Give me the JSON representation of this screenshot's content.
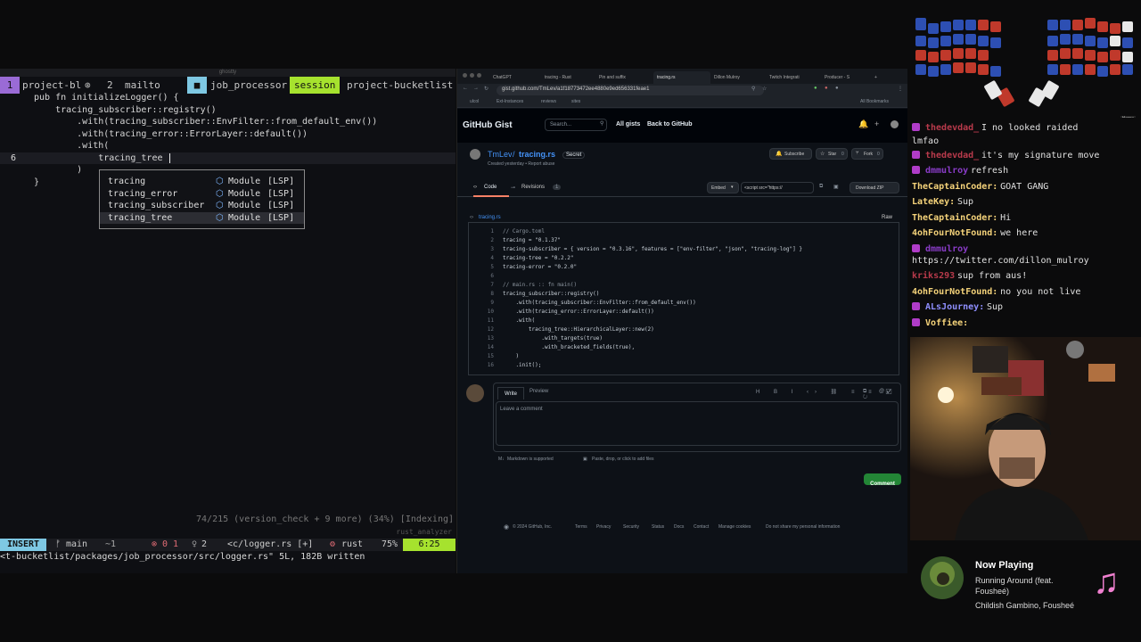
{
  "terminal": {
    "window_title": "ghostty",
    "tabs": [
      {
        "index": "1",
        "label": "project-bl"
      },
      {
        "index": "2",
        "label": "mailto"
      },
      {
        "label": "job_processor"
      },
      {
        "label": "session"
      },
      {
        "label": "project-bucketlist"
      }
    ],
    "code_lines": [
      {
        "ln": "",
        "text": "pub fn initializeLogger() {"
      },
      {
        "ln": "",
        "text": "    tracing_subscriber::registry()"
      },
      {
        "ln": "",
        "text": "        .with(tracing_subscriber::EnvFilter::from_default_env())"
      },
      {
        "ln": "",
        "text": "        .with(tracing_error::ErrorLayer::default())"
      },
      {
        "ln": "",
        "text": "        .with("
      },
      {
        "ln": "6",
        "text": "            tracing_tree"
      },
      {
        "ln": "",
        "text": "        )"
      },
      {
        "ln": "",
        "text": "}"
      }
    ],
    "completions": [
      {
        "name": "tracing",
        "kind": "Module",
        "src": "[LSP]"
      },
      {
        "name": "tracing_error",
        "kind": "Module",
        "src": "[LSP]"
      },
      {
        "name": "tracing_subscriber",
        "kind": "Module",
        "src": "[LSP]"
      },
      {
        "name": "tracing_tree",
        "kind": "Module",
        "src": "[LSP]"
      }
    ],
    "lsp_progress": "74/215 (version_check + 9 more) (34%) [Indexing]",
    "lsp_name": "rust_analyzer",
    "status": {
      "mode": "INSERT",
      "branch": "main",
      "diff": "~1",
      "errors": "0 1",
      "warnings": "1",
      "hints": "2",
      "file": "<c/logger.rs [+]",
      "filetype": "rust",
      "percent": "75%",
      "position": "6:25"
    },
    "cmdline": "<t-bucketlist/packages/job_processor/src/logger.rs\" 5L, 182B written"
  },
  "browser": {
    "tabs": [
      "ChatGPT",
      "tracing - Rust",
      "Pin and suffix",
      "tracing.rs",
      "Dillon Mulroy",
      "Twitch Integrati",
      "Producer - S"
    ],
    "url": "gist.github.com/TmLev/a1f18773472ee4880e9ed656331feae1",
    "bookmarks": [
      "ulcol",
      "Ext-Instances",
      "reviews",
      "sites"
    ],
    "all_bookmarks": "All Bookmarks",
    "logo": "GitHub Gist",
    "search_placeholder": "Search...",
    "nav": [
      "All gists",
      "Back to GitHub"
    ],
    "owner": "TmLev",
    "file": "tracing.rs",
    "secret_badge": "Secret",
    "created": "Created yesterday • Report abuse",
    "subscribe": "Subscribe",
    "star": "Star",
    "star_count": "0",
    "fork": "Fork",
    "fork_count": "0",
    "code_tab": "Code",
    "revisions_tab": "Revisions",
    "revisions_count": "1",
    "embed": "Embed",
    "embed_value": "<script src=\"https://",
    "download": "Download ZIP",
    "filename": "tracing.rs",
    "raw": "Raw",
    "gist_lines": [
      {
        "n": "1",
        "t": "// Cargo.toml"
      },
      {
        "n": "2",
        "t": "tracing = \"0.1.37\""
      },
      {
        "n": "3",
        "t": "tracing-subscriber = { version = \"0.3.16\", features = [\"env-filter\", \"json\", \"tracing-log\"] }"
      },
      {
        "n": "4",
        "t": "tracing-tree = \"0.2.2\""
      },
      {
        "n": "5",
        "t": "tracing-error = \"0.2.0\""
      },
      {
        "n": "6",
        "t": ""
      },
      {
        "n": "7",
        "t": "// main.rs :: fn main()"
      },
      {
        "n": "8",
        "t": "tracing_subscriber::registry()"
      },
      {
        "n": "9",
        "t": "    .with(tracing_subscriber::EnvFilter::from_default_env())"
      },
      {
        "n": "10",
        "t": "    .with(tracing_error::ErrorLayer::default())"
      },
      {
        "n": "11",
        "t": "    .with("
      },
      {
        "n": "12",
        "t": "        tracing_tree::HierarchicalLayer::new(2)"
      },
      {
        "n": "13",
        "t": "            .with_targets(true)"
      },
      {
        "n": "14",
        "t": "            .with_bracketed_fields(true),"
      },
      {
        "n": "15",
        "t": "    )"
      },
      {
        "n": "16",
        "t": "    .init();"
      }
    ],
    "comment": {
      "write_tab": "Write",
      "preview_tab": "Preview",
      "placeholder": "Leave a comment",
      "markdown_note": "Markdown is supported",
      "attach_note": "Paste, drop, or click to add files",
      "submit": "Comment"
    },
    "footer": [
      "© 2024 GitHub, Inc.",
      "Terms",
      "Privacy",
      "Security",
      "Status",
      "Docs",
      "Contact",
      "Manage cookies",
      "Do not share my personal information"
    ]
  },
  "chat": {
    "messages": [
      {
        "user": "thedevdad_",
        "text": "I no looked raided",
        "color": "#b83a4b",
        "badge": "#b03cc8"
      },
      {
        "user": "",
        "text": "lmfao",
        "color": "#e0e0e0",
        "badge": ""
      },
      {
        "user": "thedevdad_",
        "text": "it's my signature move",
        "color": "#b83a4b",
        "badge": "#b03cc8"
      },
      {
        "user": "dmmulroy",
        "text": "refresh",
        "color": "#8a3cc8",
        "badge": "#b03cc8"
      },
      {
        "user": "TheCaptainCoder:",
        "text": "GOAT GANG",
        "color": "#f5d37a",
        "badge": ""
      },
      {
        "user": "LateKey:",
        "text": "Sup",
        "color": "#f5d37a",
        "badge": ""
      },
      {
        "user": "TheCaptainCoder:",
        "text": "Hi",
        "color": "#f5d37a",
        "badge": ""
      },
      {
        "user": "4ohFourNotFound:",
        "text": "we here",
        "color": "#f5d37a",
        "badge": ""
      },
      {
        "user": "dmmulroy",
        "text": "",
        "color": "#8a3cc8",
        "badge": "#b03cc8"
      },
      {
        "user": "",
        "text": "https://twitter.com/dillon_mulroy",
        "color": "#e0e0e0",
        "badge": ""
      },
      {
        "user": "kriks293",
        "text": "sup from aus!",
        "color": "#b83a4b",
        "badge": ""
      },
      {
        "user": "4ohFourNotFound:",
        "text": "no you not live",
        "color": "#f5d37a",
        "badge": ""
      },
      {
        "user": "ALsJourney:",
        "text": "Sup",
        "color": "#8f8fff",
        "badge": "#b03cc8"
      },
      {
        "user": "Voffiee:",
        "text": "",
        "color": "#f5d37a",
        "badge": "#b03cc8"
      }
    ]
  },
  "now_playing": {
    "heading": "Now Playing",
    "track": "Running Around (feat.",
    "track2": "Fousheé)",
    "artist": "Childish Gambino, Fousheé"
  },
  "keyboard": {
    "label": "Home"
  },
  "colors": {
    "session_tab": "#a6e22e",
    "status_mode": "#7ec8e3",
    "gh_green": "#238636",
    "gh_blue": "#4493f8"
  }
}
